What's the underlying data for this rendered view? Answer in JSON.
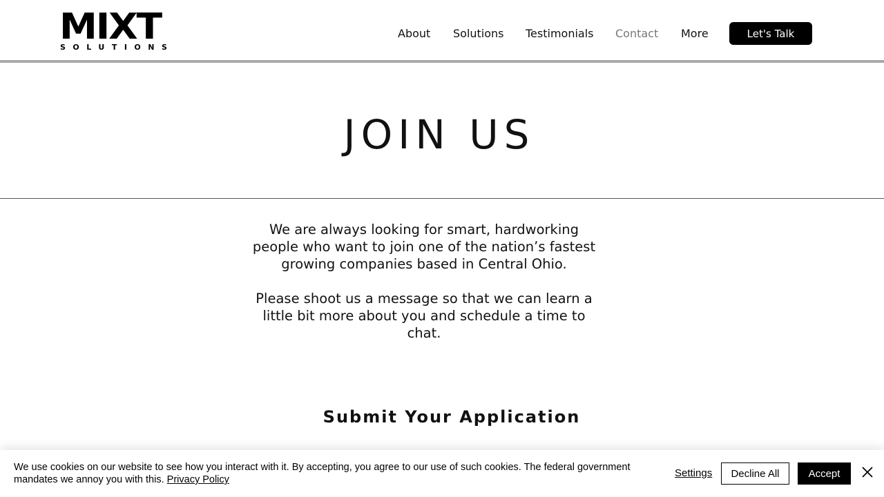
{
  "header": {
    "logo": {
      "main": "MIXT",
      "sub": "SOLUTIONS"
    },
    "nav": [
      {
        "label": "About"
      },
      {
        "label": "Solutions"
      },
      {
        "label": "Testimonials"
      },
      {
        "label": "Contact",
        "active": true
      },
      {
        "label": "More"
      }
    ],
    "cta_label": "Let's Talk"
  },
  "hero": {
    "title": "JOIN US"
  },
  "intro": {
    "paragraph1": "We are always looking for smart, hardworking people who want to join one of the nation’s fastest growing companies based in Central Ohio.",
    "paragraph2": "Please shoot us a message so that we can learn a little bit more about you and schedule a time to chat."
  },
  "submit": {
    "heading": "Submit Your Application"
  },
  "cookie_banner": {
    "text": "We use cookies on our website to see how you interact with it. By accepting, you agree to our use of such cookies. The federal government mandates we annoy you with this.",
    "link_label": "Privacy Policy",
    "settings_label": "Settings",
    "decline_label": "Decline All",
    "accept_label": "Accept",
    "close_icon": "close-icon"
  },
  "colors": {
    "brand": "#000000",
    "nav_active": "#777777",
    "header_border": "#a8a8a8"
  }
}
